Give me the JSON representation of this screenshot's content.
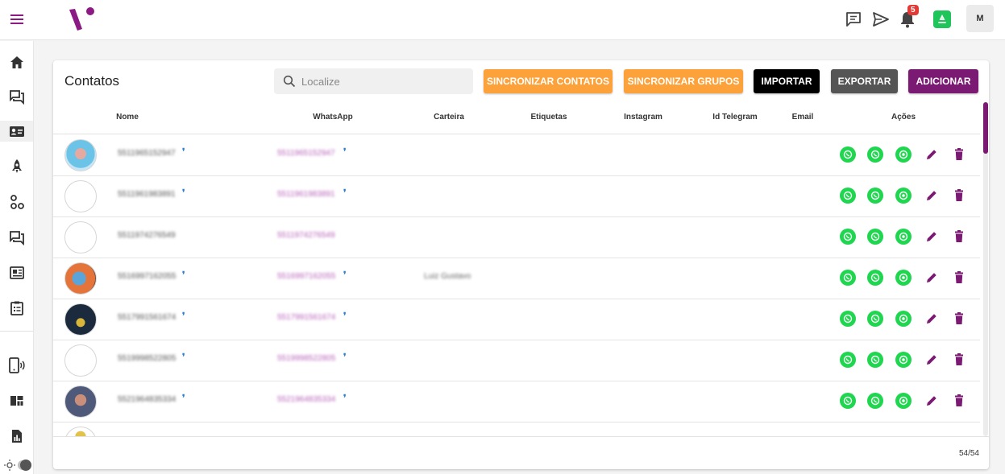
{
  "header": {
    "user_initial": "M",
    "notification_count": "5",
    "accent_color": "#8b1a84",
    "whatsapp_color": "#1fc45a"
  },
  "sidebar": {
    "items": [
      "home-icon",
      "chat-icon",
      "contacts-icon",
      "rocket-icon",
      "connections-icon",
      "queue-icon",
      "news-icon",
      "clipboard-icon",
      "device-icon",
      "dashboard-icon",
      "report-icon"
    ],
    "active": "contacts-icon"
  },
  "page": {
    "title": "Contatos",
    "search_placeholder": "Localize"
  },
  "buttons": {
    "sync_contacts": "SINCRONIZAR CONTATOS",
    "sync_groups": "SINCRONIZAR GRUPOS",
    "import": "IMPORTAR",
    "export": "EXPORTAR",
    "add": "ADICIONAR"
  },
  "table": {
    "columns": [
      "Nome",
      "WhatsApp",
      "Carteira",
      "Etiquetas",
      "Instagram",
      "Id Telegram",
      "Email",
      "Ações"
    ],
    "rows": [
      {
        "name": "5511965152947",
        "whatsapp": "5511965152947",
        "carteira": ""
      },
      {
        "name": "5511961983891",
        "whatsapp": "5511961983891",
        "carteira": ""
      },
      {
        "name": "5511974276549",
        "whatsapp": "5511974276549",
        "carteira": ""
      },
      {
        "name": "5516997162055",
        "whatsapp": "5516997162055",
        "carteira": "Luiz Gustavo"
      },
      {
        "name": "5517991561674",
        "whatsapp": "5517991561674",
        "carteira": ""
      },
      {
        "name": "5519998522805",
        "whatsapp": "5519998522805",
        "carteira": ""
      },
      {
        "name": "5521964835334",
        "whatsapp": "5521964835334",
        "carteira": ""
      }
    ]
  },
  "footer": {
    "count": "54/54"
  }
}
